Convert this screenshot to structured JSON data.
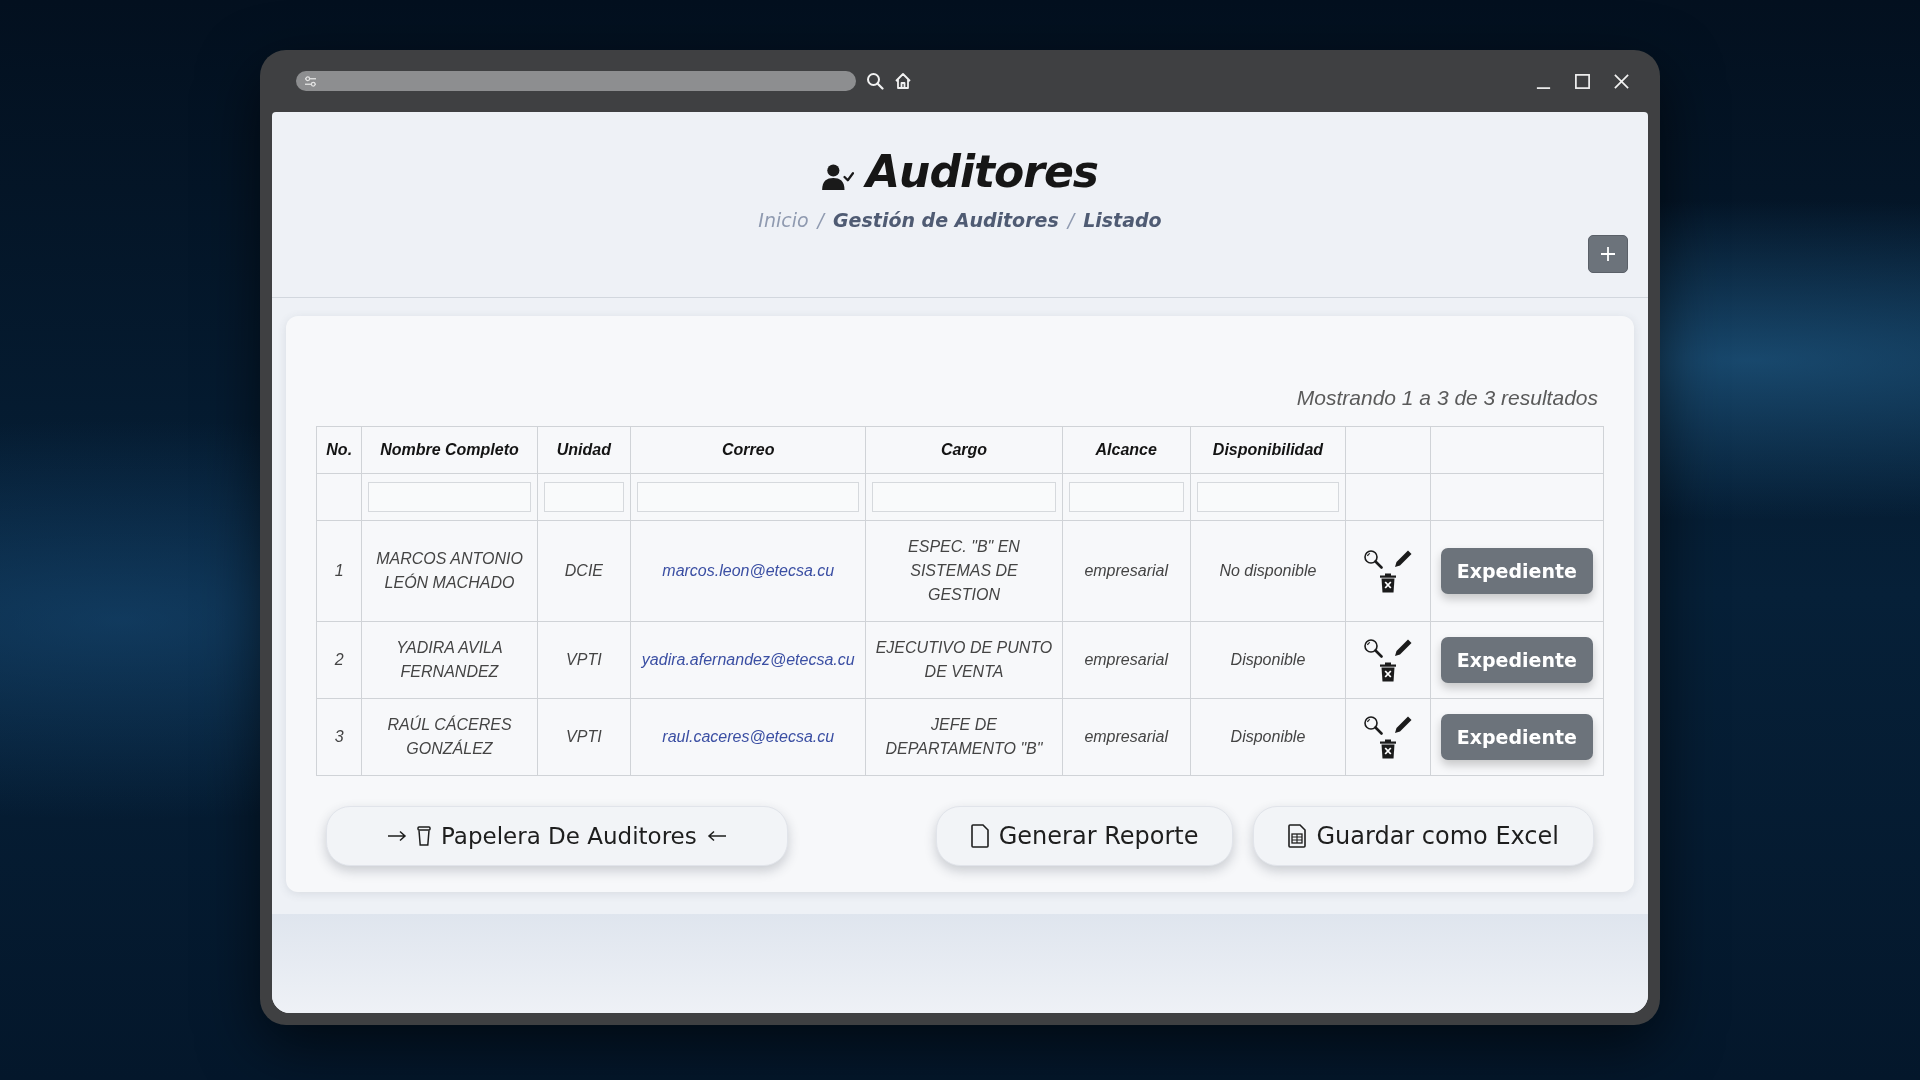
{
  "page": {
    "title": "Auditores",
    "breadcrumb": {
      "items": [
        {
          "label": "Inicio",
          "muted": true
        },
        {
          "label": "Gestión de Auditores",
          "muted": false
        },
        {
          "label": "Listado",
          "muted": false
        }
      ],
      "separators": [
        "/",
        "/"
      ]
    }
  },
  "results_summary": "Mostrando 1 a 3 de 3 resultados",
  "table": {
    "columns": [
      {
        "label": "No.",
        "kind": "number",
        "filter": false
      },
      {
        "label": "Nombre Completo",
        "kind": "text",
        "filter": true
      },
      {
        "label": "Unidad",
        "kind": "text",
        "filter": true
      },
      {
        "label": "Correo",
        "kind": "email",
        "filter": true
      },
      {
        "label": "Cargo",
        "kind": "text",
        "filter": true
      },
      {
        "label": "Alcance",
        "kind": "text",
        "filter": true
      },
      {
        "label": "Disponibilidad",
        "kind": "text",
        "filter": true
      }
    ],
    "rows": [
      {
        "cells": [
          "1",
          "MARCOS ANTONIO LEÓN MACHADO",
          "DCIE",
          "marcos.leon@etecsa.cu",
          "ESPEC. \"B\" EN SISTEMAS DE GESTION",
          "empresarial",
          "No disponible"
        ],
        "file_button": "Expediente"
      },
      {
        "cells": [
          "2",
          "YADIRA AVILA FERNANDEZ",
          "VPTI",
          "yadira.afernandez@etecsa.cu",
          "EJECUTIVO DE PUNTO DE VENTA",
          "empresarial",
          "Disponible"
        ],
        "file_button": "Expediente"
      },
      {
        "cells": [
          "3",
          "RAÚL CÁCERES GONZÁLEZ",
          "VPTI",
          "raul.caceres@etecsa.cu",
          "JEFE DE DEPARTAMENTO \"B\"",
          "empresarial",
          "Disponible"
        ],
        "file_button": "Expediente"
      }
    ]
  },
  "footer_buttons": [
    {
      "label": "Papelera De Auditores",
      "kind": "trash"
    },
    {
      "label": "Generar Reporte",
      "kind": "report"
    },
    {
      "label": "Guardar como Excel",
      "kind": "excel"
    }
  ]
}
